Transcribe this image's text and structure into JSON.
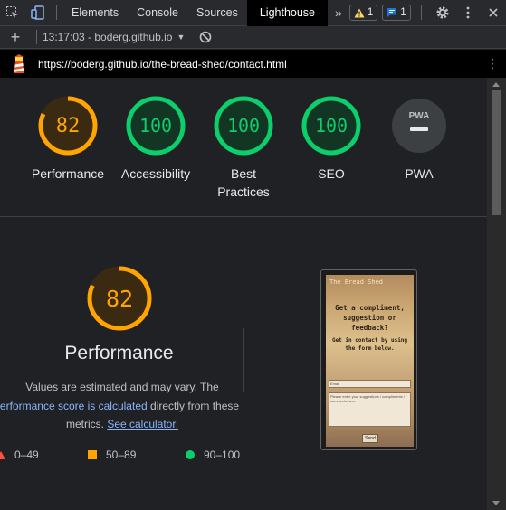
{
  "devtools": {
    "tabs": [
      "Elements",
      "Console",
      "Sources",
      "Lighthouse"
    ],
    "active_tab": "Lighthouse",
    "more_tabs_glyph": "»",
    "warnings_count": "1",
    "messages_count": "1",
    "icons": [
      "inspect-icon",
      "device-toggle-icon",
      "warning-icon",
      "message-icon",
      "settings-icon",
      "kebab-icon",
      "close-icon"
    ]
  },
  "toolbar": {
    "add_label": "+",
    "report_selector": "13:17:03 - boderg.github.io",
    "clear_icon": "block-icon"
  },
  "urlbar": {
    "url": "https://boderg.github.io/the-bread-shed/contact.html"
  },
  "scores": [
    {
      "label": "Performance",
      "value": "82",
      "fraction": 0.82,
      "color": "#ffa400"
    },
    {
      "label": "Accessibility",
      "value": "100",
      "fraction": 1.0,
      "color": "#0cce6b"
    },
    {
      "label": "Best Practices",
      "value": "100",
      "fraction": 1.0,
      "color": "#0cce6b"
    },
    {
      "label": "SEO",
      "value": "100",
      "fraction": 1.0,
      "color": "#0cce6b"
    },
    {
      "label": "PWA",
      "value": "PWA",
      "fraction": null,
      "color": "#5f6368"
    }
  ],
  "performance": {
    "score": "82",
    "fraction": 0.82,
    "title": "Performance",
    "desc_line1": "Values are estimated and may vary. The",
    "desc_link": "erformance score is calculated",
    "desc_after_link": "directly from these",
    "desc_line3": "metrics.",
    "calc_link": "See calculator.",
    "legend": [
      {
        "range": "0–49",
        "shape": "triangle",
        "color": "#ff4e42"
      },
      {
        "range": "50–89",
        "shape": "square",
        "color": "#ffa400"
      },
      {
        "range": "90–100",
        "shape": "circle",
        "color": "#0cce6b"
      }
    ]
  },
  "screenshot": {
    "brand": "The Bread Shed",
    "heading_lines": [
      "Get a compliment,",
      "suggestion or",
      "feedback?"
    ],
    "sub_lines": [
      "Get in contact by using",
      "the form below."
    ],
    "field1": "Email",
    "field2": "Please enter your suggestions / compliments / comments here",
    "send": "Send"
  },
  "colors": {
    "orange": "#ffa400",
    "green": "#0cce6b",
    "red": "#ff4e42",
    "link": "#8ab4f8"
  }
}
